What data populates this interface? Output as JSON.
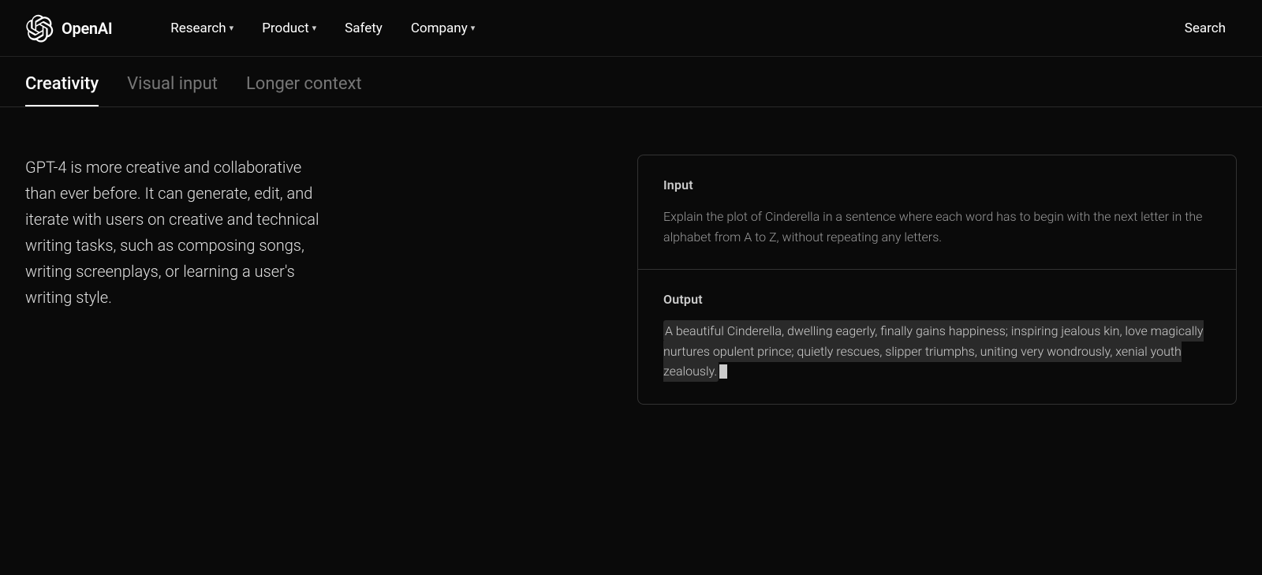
{
  "nav": {
    "logo_text": "OpenAI",
    "links": [
      {
        "label": "Research",
        "has_dropdown": true
      },
      {
        "label": "Product",
        "has_dropdown": true
      },
      {
        "label": "Safety",
        "has_dropdown": false
      },
      {
        "label": "Company",
        "has_dropdown": true
      }
    ],
    "search_label": "Search"
  },
  "tabs": [
    {
      "label": "Creativity",
      "active": true
    },
    {
      "label": "Visual input",
      "active": false
    },
    {
      "label": "Longer context",
      "active": false
    }
  ],
  "main": {
    "description": "GPT-4 is more creative and collaborative than ever before. It can generate, edit, and iterate with users on creative and technical writing tasks, such as composing songs, writing screenplays, or learning a user's writing style.",
    "demo": {
      "input_label": "Input",
      "input_text": "Explain the plot of Cinderella in a sentence where each word has to begin with the next letter in the alphabet from A to Z, without repeating any letters.",
      "output_label": "Output",
      "output_text": "A beautiful Cinderella, dwelling eagerly, finally gains happiness; inspiring jealous kin, love magically nurtures opulent prince; quietly rescues, slipper triumphs, uniting very wondrously, xenial youth zealously."
    }
  }
}
